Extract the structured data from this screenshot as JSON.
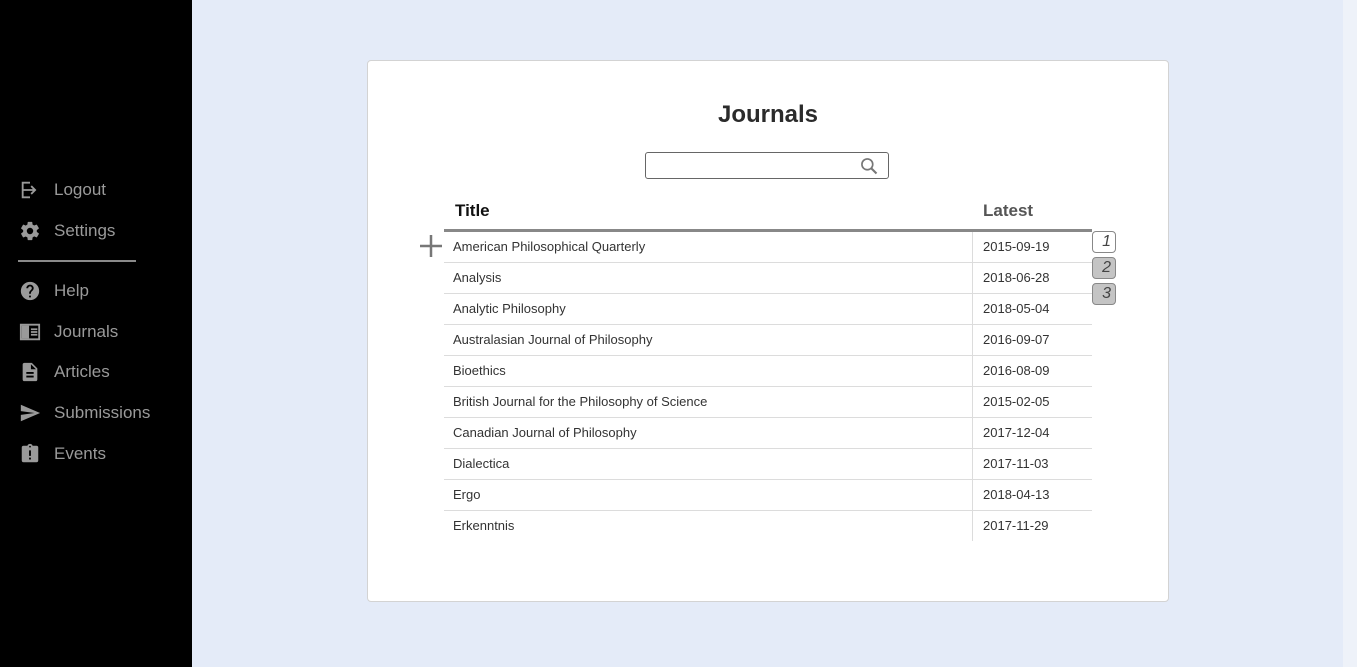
{
  "sidebar": {
    "items": [
      {
        "label": "Logout",
        "icon": "logout-icon"
      },
      {
        "label": "Settings",
        "icon": "gear-icon"
      },
      {
        "label": "Help",
        "icon": "help-icon"
      },
      {
        "label": "Journals",
        "icon": "journal-icon"
      },
      {
        "label": "Articles",
        "icon": "document-icon"
      },
      {
        "label": "Submissions",
        "icon": "send-icon"
      },
      {
        "label": "Events",
        "icon": "clipboard-alert-icon"
      }
    ]
  },
  "main": {
    "title": "Journals",
    "search": {
      "value": "",
      "placeholder": ""
    },
    "table": {
      "headers": {
        "title": "Title",
        "latest": "Latest"
      },
      "rows": [
        {
          "title": "American Philosophical Quarterly",
          "latest": "2015-09-19"
        },
        {
          "title": "Analysis",
          "latest": "2018-06-28"
        },
        {
          "title": "Analytic Philosophy",
          "latest": "2018-05-04"
        },
        {
          "title": "Australasian Journal of Philosophy",
          "latest": "2016-09-07"
        },
        {
          "title": "Bioethics",
          "latest": "2016-08-09"
        },
        {
          "title": "British Journal for the Philosophy of Science",
          "latest": "2015-02-05"
        },
        {
          "title": "Canadian Journal of Philosophy",
          "latest": "2017-12-04"
        },
        {
          "title": "Dialectica",
          "latest": "2017-11-03"
        },
        {
          "title": "Ergo",
          "latest": "2018-04-13"
        },
        {
          "title": "Erkenntnis",
          "latest": "2017-11-29"
        }
      ]
    },
    "pagination": {
      "pages": [
        "1",
        "2",
        "3"
      ],
      "current": "1"
    },
    "add_icon": "plus-icon"
  },
  "colors": {
    "background": "#e4ebf8",
    "sidebar": "#000000",
    "sidebar_text": "#9a9a9a"
  }
}
